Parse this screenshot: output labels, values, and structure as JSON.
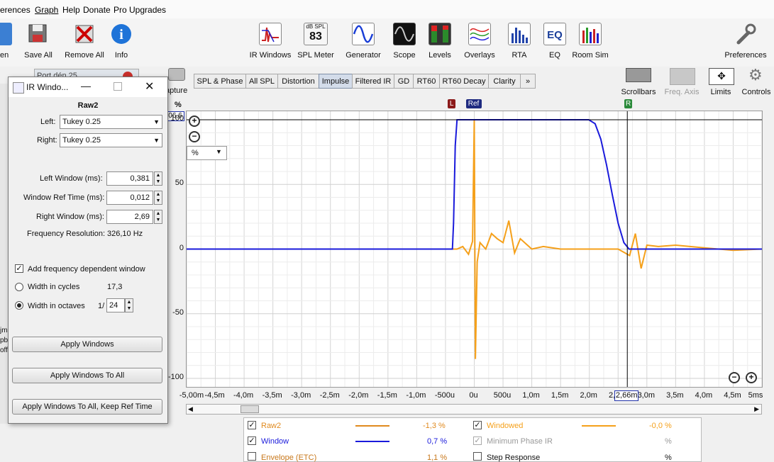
{
  "menu": [
    "erences",
    "Graph",
    "Help",
    "Donate",
    "Pro Upgrades"
  ],
  "toolbar_left": [
    {
      "label": "en",
      "icon": "open-icon"
    },
    {
      "label": "Save All",
      "icon": "save-all-icon"
    },
    {
      "label": "Remove All",
      "icon": "remove-all-icon"
    },
    {
      "label": "Info",
      "icon": "info-icon"
    }
  ],
  "toolbar_main": [
    {
      "label": "IR Windows",
      "icon": "ir-windows-icon"
    },
    {
      "label": "SPL Meter",
      "icon": "spl-meter-icon",
      "badge_top": "dB SPL",
      "badge_value": "83"
    },
    {
      "label": "Generator",
      "icon": "generator-icon"
    },
    {
      "label": "Scope",
      "icon": "scope-icon"
    },
    {
      "label": "Levels",
      "icon": "levels-icon"
    },
    {
      "label": "Overlays",
      "icon": "overlays-icon"
    },
    {
      "label": "RTA",
      "icon": "rta-icon"
    },
    {
      "label": "EQ",
      "icon": "eq-icon"
    },
    {
      "label": "Room Sim",
      "icon": "room-sim-icon"
    }
  ],
  "preferences_label": "Preferences",
  "capture_label": "apture",
  "behind_window_text": "Port dén  25",
  "view_tools": [
    {
      "label": "Scrollbars",
      "enabled": true
    },
    {
      "label": "Freq. Axis",
      "enabled": false
    },
    {
      "label": "Limits",
      "enabled": true
    },
    {
      "label": "Controls",
      "enabled": true
    }
  ],
  "tabs": [
    "SPL & Phase",
    "All SPL",
    "Distortion",
    "Impulse",
    "Filtered IR",
    "GD",
    "RT60",
    "RT60 Decay",
    "Clarity",
    "»"
  ],
  "active_tab": "Impulse",
  "graph": {
    "unit_label": "%",
    "top_value": "06,6",
    "unit_select": "%",
    "y_ticks": [
      "100",
      "50",
      "0",
      "-50",
      "-100"
    ],
    "x_ticks": [
      "-5,00m",
      "-4,5m",
      "-4,0m",
      "-3,5m",
      "-3,0m",
      "-2,5m",
      "-2,0m",
      "-1,5m",
      "-1,0m",
      "-500u",
      "0u",
      "500u",
      "1,0m",
      "1,5m",
      "2,0m",
      "2,5m",
      "3,0m",
      "3,5m",
      "4,0m",
      "4,5m",
      "5ms"
    ],
    "cursor_label": "2,66m",
    "markers": {
      "left": "L",
      "ref": "Ref",
      "right": "R"
    },
    "colors": {
      "window": "#1a1adb",
      "ir": "#f5a01a",
      "cursor": "#000000"
    }
  },
  "chart_data": {
    "type": "line",
    "xlabel": "",
    "ylabel": "%",
    "xlim": [
      -5.0,
      5.0
    ],
    "ylim": [
      -106.6,
      106.6
    ],
    "x_unit": "ms",
    "series": [
      {
        "name": "Window",
        "color": "#1a1adb",
        "x": [
          -5.0,
          -0.38,
          -0.36,
          -0.33,
          -0.3,
          1.99,
          2.1,
          2.2,
          2.3,
          2.4,
          2.5,
          2.6,
          2.69,
          5.0
        ],
        "y": [
          0,
          0,
          20,
          80,
          100,
          100,
          97,
          85,
          65,
          42,
          20,
          5,
          0,
          0
        ]
      },
      {
        "name": "Raw2",
        "color": "#f5a01a",
        "x": [
          -5.0,
          -0.4,
          -0.3,
          -0.2,
          -0.1,
          -0.03,
          0.0,
          0.02,
          0.05,
          0.1,
          0.2,
          0.3,
          0.4,
          0.5,
          0.6,
          0.7,
          0.8,
          1.0,
          1.2,
          1.5,
          2.0,
          2.5,
          2.7,
          2.8,
          2.9,
          3.0,
          3.2,
          3.5,
          4.0,
          4.5,
          5.0
        ],
        "y": [
          0,
          0,
          0,
          2,
          -4,
          6,
          100,
          -85,
          -10,
          5,
          0,
          12,
          8,
          5,
          22,
          -3,
          8,
          0,
          2,
          0,
          0,
          0,
          -5,
          12,
          -15,
          3,
          2,
          3,
          1,
          -1,
          0
        ]
      }
    ]
  },
  "dialog": {
    "title": "IR Windo...",
    "measurement": "Raw2",
    "left_label": "Left:",
    "left_value": "Tukey 0.25",
    "right_label": "Right:",
    "right_value": "Tukey 0.25",
    "left_window_label": "Left Window (ms):",
    "left_window_value": "0,381",
    "ref_time_label": "Window Ref Time (ms):",
    "ref_time_value": "0,012",
    "right_window_label": "Right Window (ms):",
    "right_window_value": "2,69",
    "freq_res_label": "Frequency Resolution:",
    "freq_res_value": "326,10 Hz",
    "fdw_label": "Add frequency dependent window",
    "fdw_checked": true,
    "cycles_label": "Width in cycles",
    "cycles_value": "17,3",
    "octaves_label": "Width in octaves",
    "octaves_prefix": "1/",
    "octaves_value": "24",
    "btn_apply": "Apply Windows",
    "btn_apply_all": "Apply Windows To All",
    "btn_apply_all_keep": "Apply Windows To All, Keep Ref Time"
  },
  "left_fragments": [
    "jms",
    "pb",
    "off"
  ],
  "legend": [
    {
      "label": "Raw2",
      "checked": true,
      "color": "#e08a1e",
      "value": "-1,3 %",
      "enabled": true
    },
    {
      "label": "Window",
      "checked": true,
      "color": "#1a1adb",
      "value": "0,7 %",
      "enabled": true
    },
    {
      "label": "Envelope (ETC)",
      "checked": false,
      "color": "",
      "value": "1,1 %",
      "enabled": true
    },
    {
      "label": "Windowed",
      "checked": true,
      "color": "#f5a01a",
      "value": "-0,0 %",
      "enabled": true
    },
    {
      "label": "Minimum Phase IR",
      "checked": true,
      "color": "",
      "value": "%",
      "enabled": false
    },
    {
      "label": "Step Response",
      "checked": false,
      "color": "",
      "value": "%",
      "enabled": true
    }
  ]
}
